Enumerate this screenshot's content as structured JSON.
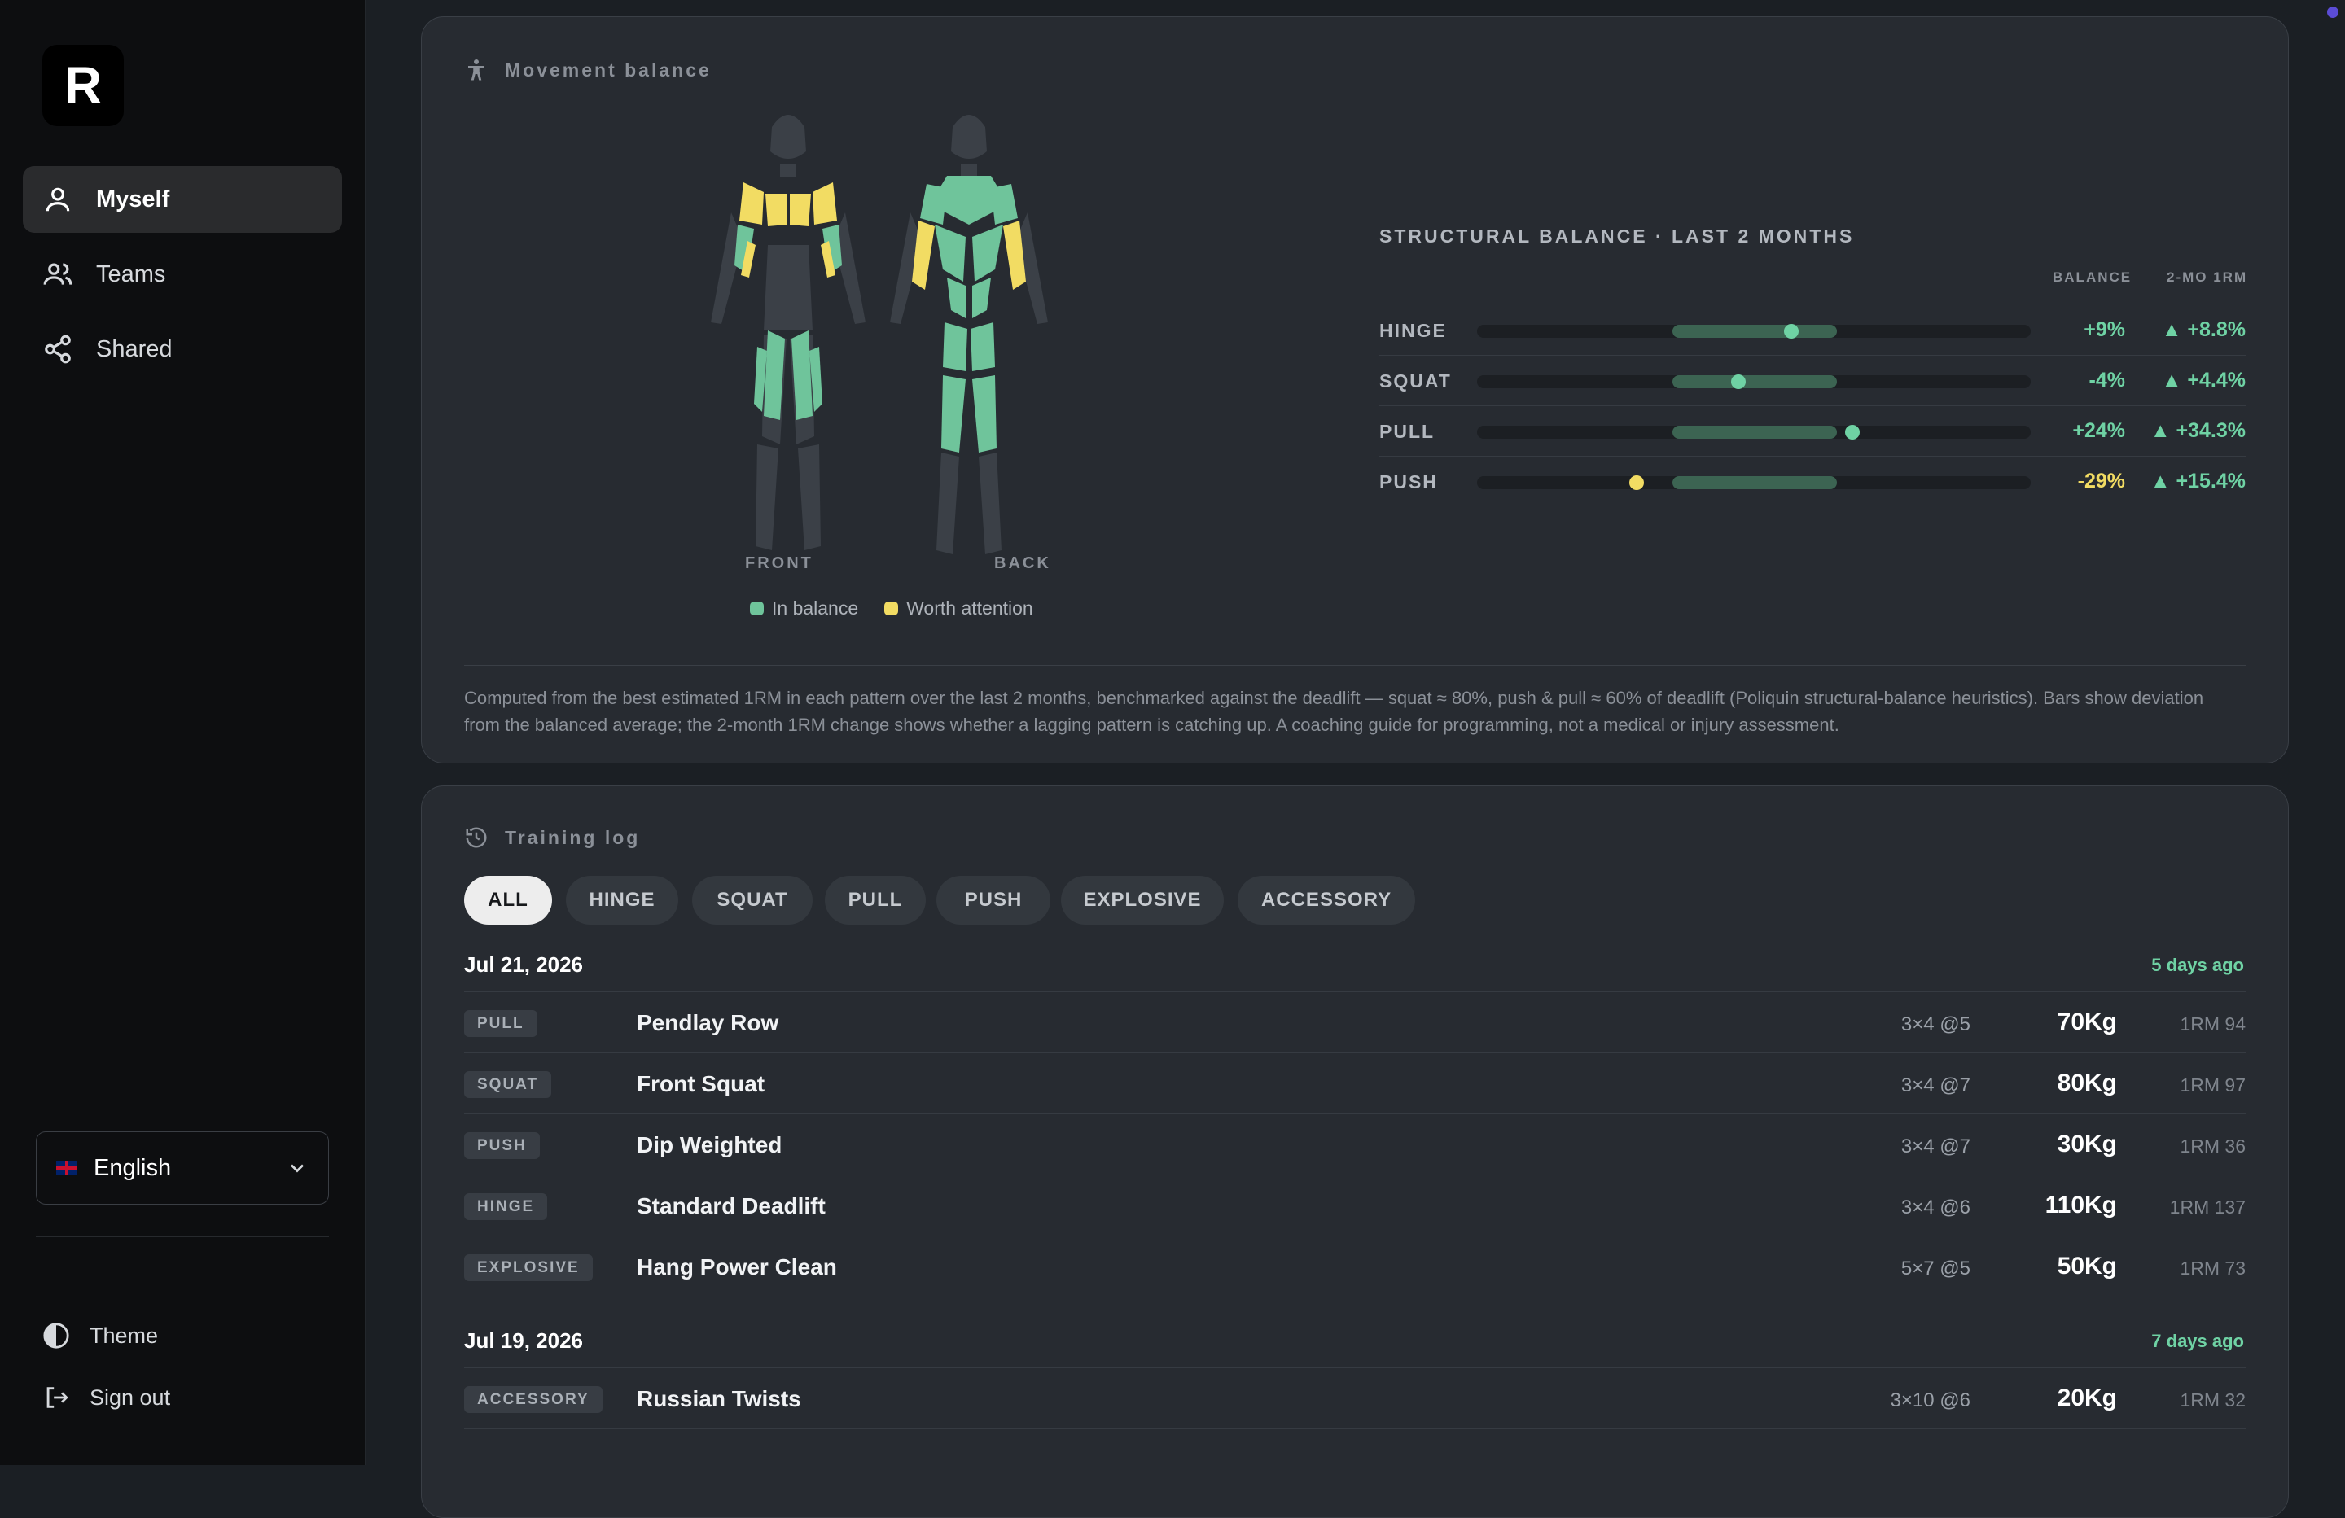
{
  "app": {
    "logo_text": "R"
  },
  "sidebar": {
    "items": [
      {
        "label": "Myself",
        "icon": "person-icon",
        "active": true
      },
      {
        "label": "Teams",
        "icon": "users-icon",
        "active": false
      },
      {
        "label": "Shared",
        "icon": "share-icon",
        "active": false
      }
    ],
    "language": {
      "selected": "English",
      "flag": "uk-flag-icon"
    },
    "theme_label": "Theme",
    "signout_label": "Sign out"
  },
  "movement": {
    "title": "Movement balance",
    "front_label": "FRONT",
    "back_label": "BACK",
    "legend": [
      {
        "label": "In balance",
        "color": "#6fc49b"
      },
      {
        "label": "Worth attention",
        "color": "#f2dc63"
      }
    ],
    "balance_title": "STRUCTURAL BALANCE · LAST 2 MONTHS",
    "col_balance": "BALANCE",
    "col_change": "2-MO 1RM",
    "rows": [
      {
        "name": "HINGE",
        "balance": "+9%",
        "balance_value": 9,
        "change": "▲ +8.8%",
        "status": "ok"
      },
      {
        "name": "SQUAT",
        "balance": "-4%",
        "balance_value": -4,
        "change": "▲ +4.4%",
        "status": "ok"
      },
      {
        "name": "PULL",
        "balance": "+24%",
        "balance_value": 24,
        "change": "▲ +34.3%",
        "status": "ok"
      },
      {
        "name": "PUSH",
        "balance": "-29%",
        "balance_value": -29,
        "change": "▲ +15.4%",
        "status": "attention"
      }
    ],
    "note": "Computed from the best estimated 1RM in each pattern over the last 2 months, benchmarked against the deadlift — squat ≈ 80%, push & pull ≈ 60% of deadlift (Poliquin structural-balance heuristics). Bars show deviation from the balanced average; the 2-month 1RM change shows whether a lagging pattern is catching up. A coaching guide for programming, not a medical or injury assessment."
  },
  "log": {
    "title": "Training log",
    "filters": [
      "ALL",
      "HINGE",
      "SQUAT",
      "PULL",
      "PUSH",
      "EXPLOSIVE",
      "ACCESSORY"
    ],
    "active_filter": "ALL",
    "days": [
      {
        "date": "Jul 21, 2026",
        "ago": "5 days ago",
        "entries": [
          {
            "tag": "PULL",
            "name": "Pendlay Row",
            "sets": "3×4 @5",
            "weight": "70Kg",
            "rm": "1RM 94"
          },
          {
            "tag": "SQUAT",
            "name": "Front Squat",
            "sets": "3×4 @7",
            "weight": "80Kg",
            "rm": "1RM 97"
          },
          {
            "tag": "PUSH",
            "name": "Dip Weighted",
            "sets": "3×4 @7",
            "weight": "30Kg",
            "rm": "1RM 36"
          },
          {
            "tag": "HINGE",
            "name": "Standard Deadlift",
            "sets": "3×4 @6",
            "weight": "110Kg",
            "rm": "1RM 137"
          },
          {
            "tag": "EXPLOSIVE",
            "name": "Hang Power Clean",
            "sets": "5×7 @5",
            "weight": "50Kg",
            "rm": "1RM 73"
          }
        ]
      },
      {
        "date": "Jul 19, 2026",
        "ago": "7 days ago",
        "entries": [
          {
            "tag": "ACCESSORY",
            "name": "Russian Twists",
            "sets": "3×10 @6",
            "weight": "20Kg",
            "rm": "1RM 32"
          }
        ]
      }
    ]
  },
  "colors": {
    "ok": "#6fd2a4",
    "attention": "#f2dc63",
    "muscle_ok": "#6fc49b",
    "muscle_attention": "#f2dc63",
    "muscle_neutral": "#3b4047"
  }
}
